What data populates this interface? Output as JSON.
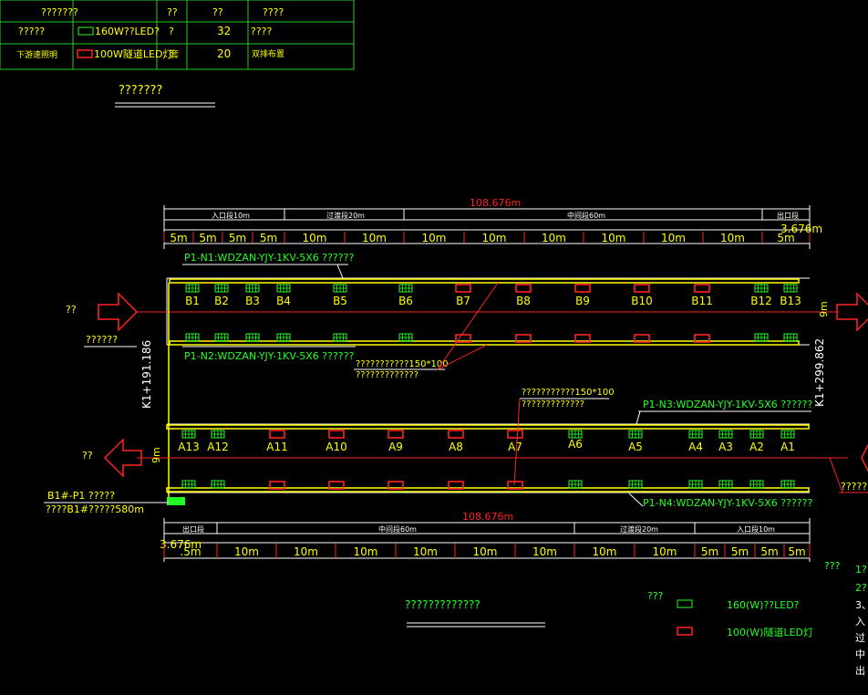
{
  "legend_table": {
    "headers": [
      "???????",
      "??",
      "??",
      "????"
    ],
    "rows": [
      {
        "name": "?????",
        "spec": "160W??LED?",
        "unit": "?",
        "qty": "32",
        "note": "????"
      },
      {
        "name": "下游速照明",
        "spec": "100W隧道LED灯",
        "unit": "套",
        "qty": "20",
        "note": "双排布置"
      }
    ],
    "caption": "???????"
  },
  "top_dims": {
    "total": "108.676m",
    "sections": [
      "入口段10m",
      "过渡段20m",
      "中间段60m",
      "出口段"
    ],
    "sub": [
      "5m",
      "5m",
      "5m",
      "5m",
      "10m",
      "10m",
      "10m",
      "10m",
      "10m",
      "10m",
      "10m",
      "10m",
      "5m"
    ],
    "edge": "3.676m"
  },
  "bottom_dims": {
    "total": "108.676m",
    "sections": [
      "出口段",
      "中间段60m",
      "过渡段20m",
      "入口段10m"
    ],
    "sub": [
      ".5m",
      "10m",
      "10m",
      "10m",
      "10m",
      "10m",
      "10m",
      "10m",
      "10m",
      "5m",
      "5m",
      "5m",
      "5m"
    ],
    "edge": "3.676m"
  },
  "upper_tunnel": {
    "labels": [
      "B1",
      "B2",
      "B3",
      "B4",
      "B5",
      "B6",
      "B7",
      "B8",
      "B9",
      "B10",
      "B11",
      "B12",
      "B13"
    ],
    "cable_n1": "P1-N1:WDZAN-YJY-1KV-5X6 ??????",
    "cable_n2": "P1-N2:WDZAN-YJY-1KV-5X6 ??????",
    "tray_note": "???????????150*100",
    "tray_note2": "?????????????",
    "direction": "??",
    "direction2": "??????",
    "width": "9m"
  },
  "lower_tunnel": {
    "labels": [
      "A13",
      "A12",
      "A11",
      "A10",
      "A9",
      "A8",
      "A7",
      "A6",
      "A5",
      "A4",
      "A3",
      "A2",
      "A1"
    ],
    "cable_n3": "P1-N3:WDZAN-YJY-1KV-5X6 ??????",
    "cable_n4": "P1-N4:WDZAN-YJY-1KV-5X6 ??????",
    "tray_note": "???????????150*100",
    "tray_note2": "?????????????",
    "direction": "??",
    "direction2": "??????",
    "width": "9m"
  },
  "stations": {
    "left": "K1+191.186",
    "right": "K1+299.862"
  },
  "feeder": {
    "line1": "B1#-P1 ?????",
    "line2": "????B1#?????580m"
  },
  "footer": {
    "plan_title": "?????????????",
    "legend_title": "???",
    "legend_green": "160(W)??LED?",
    "legend_red": "100(W)隧道LED灯",
    "notes_title": "???",
    "notes": [
      "1?",
      "2?",
      "3、",
      "入",
      "过",
      "中",
      "出"
    ]
  },
  "colors": {
    "yellow": "#ffff00",
    "green": "#22ff22",
    "red": "#ff2222",
    "white": "#ffffff",
    "background": "#000000"
  }
}
